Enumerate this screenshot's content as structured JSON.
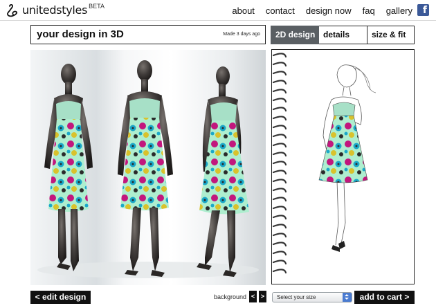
{
  "header": {
    "logo_text": "unitedstyles",
    "logo_badge": "BETA",
    "nav": [
      "about",
      "contact",
      "design now",
      "faq",
      "gallery"
    ],
    "facebook_icon": "facebook-icon",
    "facebook_glyph": "f"
  },
  "view3d": {
    "title": "your design in 3D",
    "meta": "Made 3 days ago"
  },
  "tabs": [
    "2D design",
    "details",
    "size & fit"
  ],
  "active_tab": "2D design",
  "footer": {
    "edit_label": "< edit design",
    "background_label": "background",
    "prev_label": "<",
    "next_label": ">",
    "size_select_value": "Select your size",
    "cart_label": "add to cart >"
  },
  "colors": {
    "mannequin": "#3e3a38",
    "bodice": "#a7e0c7",
    "print_base": "#aeeecf",
    "print_magenta": "#c2177d",
    "print_cyan": "#1aa8c9",
    "print_yellow": "#d9c22c",
    "print_dark": "#2a2a2a",
    "facebook_blue": "#3b5998",
    "active_tab": "#5a5f63"
  }
}
